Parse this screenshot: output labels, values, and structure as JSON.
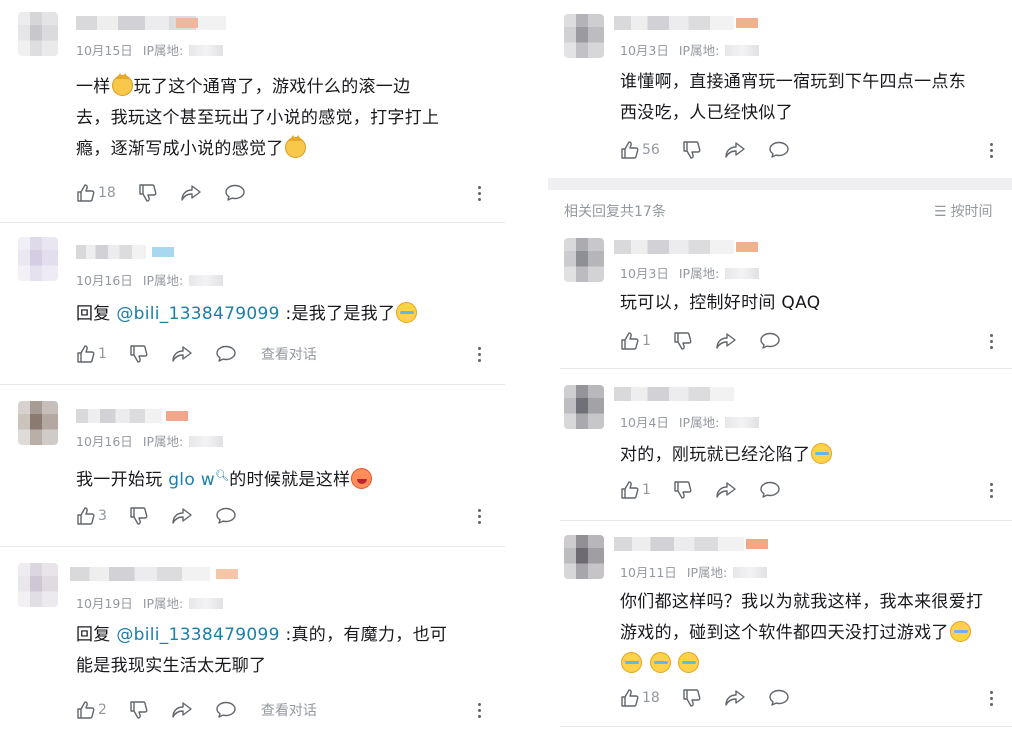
{
  "ip_label": "IP属地:",
  "left": [
    {
      "date": "10月15日",
      "avatar_color": "#c8c8cc",
      "badge_color": "#f2b6a0",
      "text_parts": [
        {
          "t": "text",
          "v": "一样"
        },
        {
          "t": "emoji",
          "v": "cat-face-emoji"
        },
        {
          "t": "text",
          "v": "玩了这个通宵了，游戏什么的滚一边"
        }
      ],
      "lines": [
        "去，我玩这个甚至玩出了小说的感觉，打字打上",
        "瘾，逐渐写成小说的感觉了"
      ],
      "likes": "18",
      "view": ""
    },
    {
      "date": "10月16日",
      "avatar_color": "#d4cde3",
      "badge_color": "#a8d8f0",
      "reply_prefix": "回复 ",
      "mention": "@bili_1338479099",
      "reply_text": " :是我了是我了",
      "likes": "1",
      "view": "查看对话"
    },
    {
      "date": "10月16日",
      "avatar_color": "#8a7a70",
      "badge_color": "#f2a78c",
      "prefix": "我一开始玩 ",
      "keyword": "glo w",
      "suffix": "的时候就是这样",
      "likes": "3",
      "view": ""
    },
    {
      "date": "10月19日",
      "avatar_color": "#cfc8d4",
      "badge_color": "#f6c6a8",
      "reply_prefix": "回复 ",
      "mention": "@bili_1338479099",
      "reply_text": " :真的，有魔力，也可",
      "line2": "能是我现实生活太无聊了",
      "likes": "2",
      "view": "查看对话"
    }
  ],
  "right_top": {
    "date": "10月3日",
    "avatar_color": "#9a9aa0",
    "badge_color": "#f2b08e",
    "line1": "谁懂啊，直接通宵玩一宿玩到下午四点一点东",
    "line2": "西没吃，人已经快似了",
    "likes": "56"
  },
  "summary": "相关回复共17条",
  "sort_label": "按时间",
  "right": [
    {
      "date": "10月3日",
      "avatar_color": "#8f8f96",
      "badge_color": "#f2b08e",
      "text": "玩可以，控制好时间 QAQ",
      "likes": "1"
    },
    {
      "date": "10月4日",
      "avatar_color": "#707078",
      "badge_color": "#e8e8ea",
      "text": "对的，刚玩就已经沦陷了",
      "likes": "1"
    },
    {
      "date": "10月11日",
      "avatar_color": "#6d6a72",
      "badge_color": "#f2a882",
      "line1": "你们都这样吗？我以为就我这样，我本来很爱打",
      "line2": "游戏的，碰到这个软件都四天没打过游戏了",
      "likes": "18"
    }
  ]
}
